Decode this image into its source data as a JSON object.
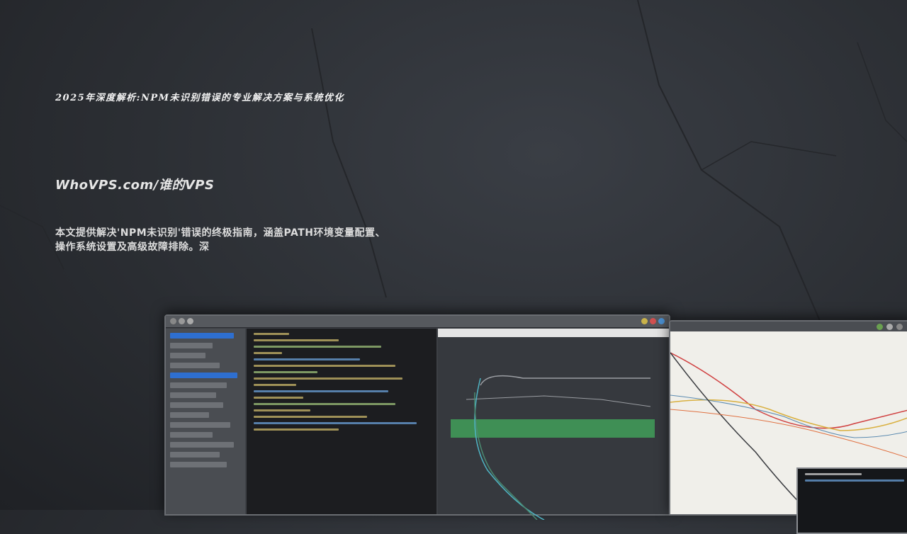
{
  "banner": {
    "title": "2025年深度解析:NPM未识别错误的专业解决方案与系统优化",
    "site": "WhoVPS.com/谁的VPS",
    "description_line1": "本文提供解决'NPM未识别'错误的终极指南，涵盖PATH环境变量配置、",
    "description_line2": "操作系统设置及高级故障排除。深"
  },
  "colors": {
    "background": "#2b2e33",
    "text": "#f2f2f2",
    "accent_blue": "#2e6fd0",
    "accent_green": "#3f8f55"
  }
}
